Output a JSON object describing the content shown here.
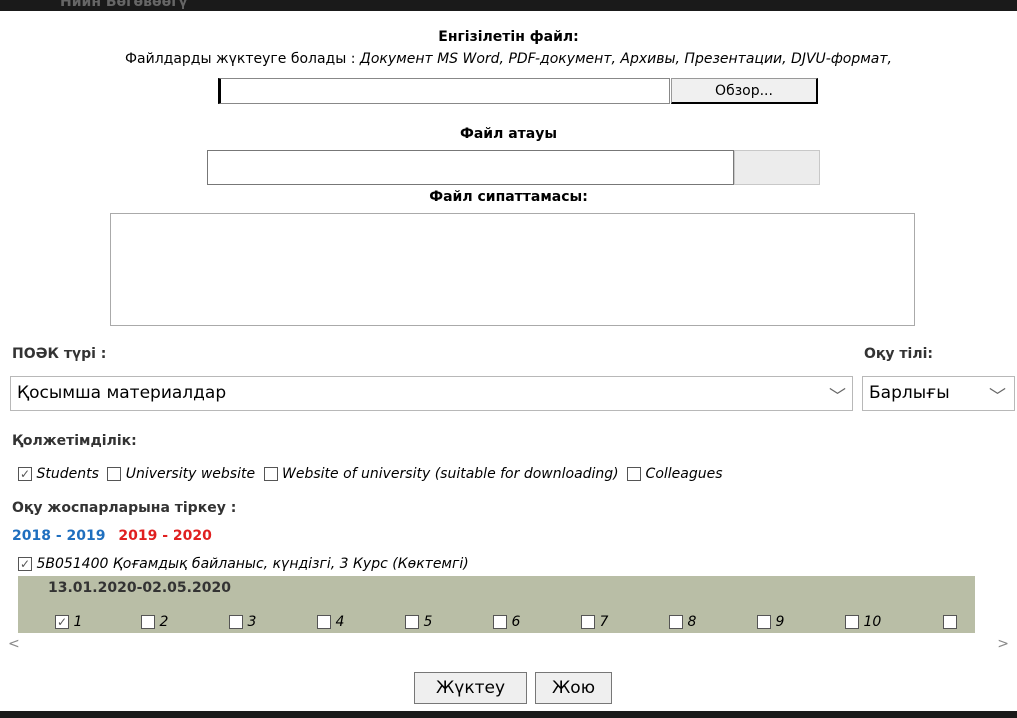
{
  "header_ghost": "Нийн Бөгөвөөгү",
  "upload": {
    "title": "Енгізілетін файл:",
    "allowed_label": "Файлдарды жүктеуге болады :",
    "allowed_types": "Документ MS Word, PDF-документ, Архивы, Презентации, DJVU-формат,",
    "browse_label": "Обзор..."
  },
  "file_name": {
    "label": "Файл атауы"
  },
  "description": {
    "label": "Файл сипаттамасы:"
  },
  "poek": {
    "label": "ПОӘК түрі :",
    "selected": "Қосымша материалдар"
  },
  "language": {
    "label": "Оқу тілі:",
    "selected": "Барлығы"
  },
  "access": {
    "label": "Қолжетімділік:",
    "options": [
      {
        "label": "Students",
        "checked": true
      },
      {
        "label": "University website",
        "checked": false
      },
      {
        "label": "Website of university (suitable for downloading)",
        "checked": false
      },
      {
        "label": "Colleagues",
        "checked": false
      }
    ]
  },
  "plans": {
    "label": "Оқу жоспарларына тіркеу :",
    "year1": "2018 - 2019",
    "year2": "2019 - 2020",
    "program": "5В051400 Қоғамдық байланыс, күндізгі, 3 Курс (Көктемгі)",
    "program_checked": true,
    "date_range": "13.01.2020-02.05.2020",
    "weeks": [
      {
        "label": "1",
        "checked": true
      },
      {
        "label": "2",
        "checked": false
      },
      {
        "label": "3",
        "checked": false
      },
      {
        "label": "4",
        "checked": false
      },
      {
        "label": "5",
        "checked": false
      },
      {
        "label": "6",
        "checked": false
      },
      {
        "label": "7",
        "checked": false
      },
      {
        "label": "8",
        "checked": false
      },
      {
        "label": "9",
        "checked": false
      },
      {
        "label": "10",
        "checked": false
      },
      {
        "label": "",
        "checked": false
      }
    ]
  },
  "actions": {
    "upload": "Жүктеу",
    "delete": "Жою"
  },
  "icons": {
    "chevron": "chevron-down-icon",
    "check": "checkbox-check-icon",
    "scroll": "scroll-arrow-icon"
  }
}
